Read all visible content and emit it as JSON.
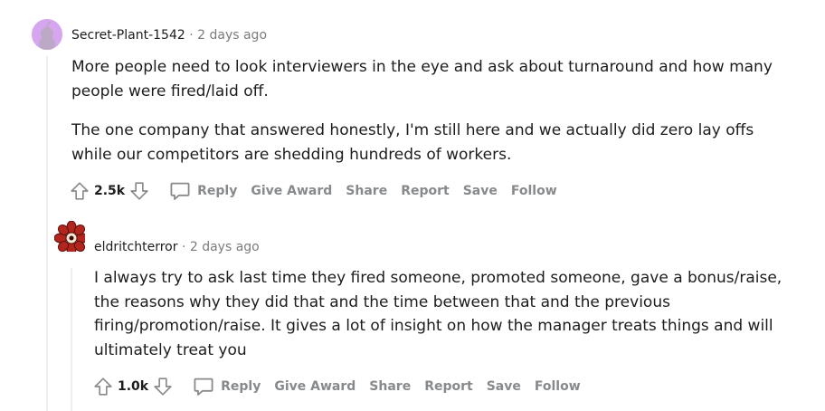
{
  "comments": [
    {
      "author": "Secret-Plant-1542",
      "separator": "·",
      "time": "2 days ago",
      "paragraphs": [
        "More people need to look interviewers in the eye and ask about turnaround and how many people were fired/laid off.",
        "The one company that answered honestly, I'm still here and we actually did zero lay offs while our competitors are shedding hundreds of workers."
      ],
      "score": "2.5k",
      "actions": {
        "reply": "Reply",
        "award": "Give Award",
        "share": "Share",
        "report": "Report",
        "save": "Save",
        "follow": "Follow"
      },
      "avatar_color": "#d7a6f0"
    },
    {
      "author": "eldritchterror",
      "separator": "·",
      "time": "2 days ago",
      "paragraphs": [
        "I always try to ask last time they fired someone, promoted someone, gave a bonus/raise, the reasons why they did that and the time between that and the previous firing/promotion/raise. It gives a lot of insight on how the manager treats things and will ultimately treat you"
      ],
      "score": "1.0k",
      "actions": {
        "reply": "Reply",
        "award": "Give Award",
        "share": "Share",
        "report": "Report",
        "save": "Save",
        "follow": "Follow"
      },
      "avatar_color": "#b3261e"
    }
  ],
  "icons": {
    "upvote": "upvote-arrow-icon",
    "downvote": "downvote-arrow-icon",
    "comment": "speech-bubble-icon"
  }
}
